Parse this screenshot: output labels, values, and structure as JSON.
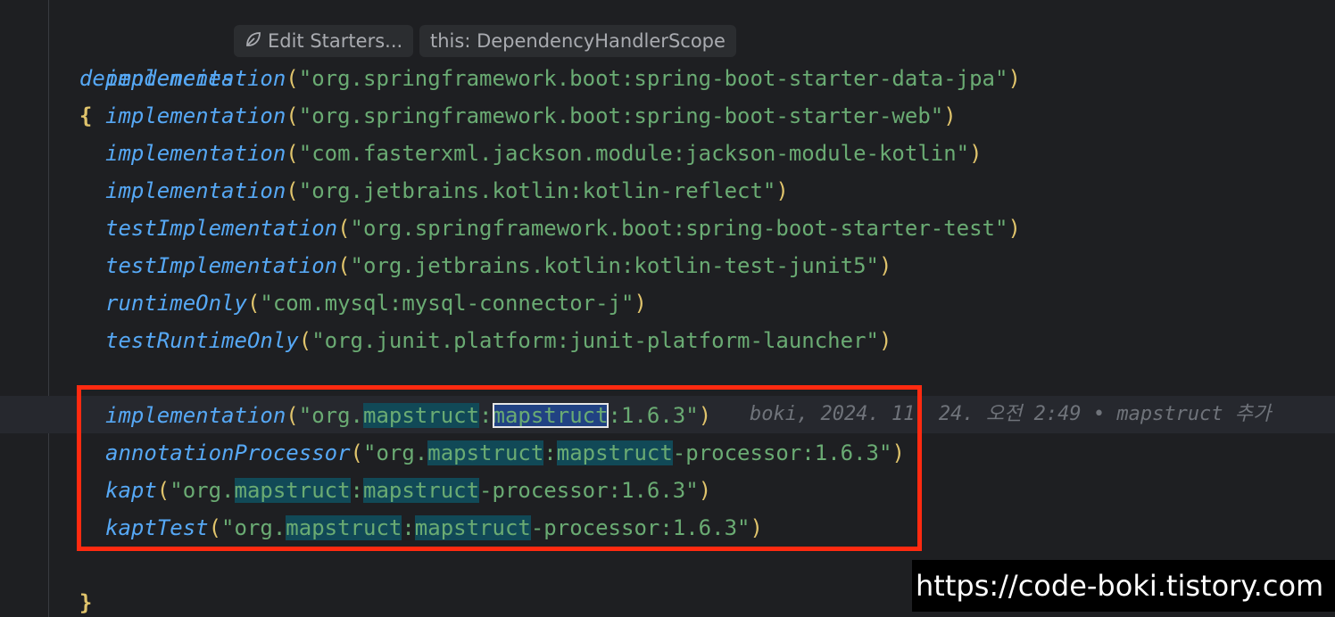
{
  "editor": {
    "block_keyword": "dependencies",
    "open_brace": "{",
    "close_brace": "}",
    "edit_starters_hint": "Edit Starters...",
    "scope_hint": "this: DependencyHandlerScope",
    "lines": [
      {
        "fn": "implementation",
        "pre": "\"org.springframework.boot:spring-boot-starter-data-jpa\""
      },
      {
        "fn": "implementation",
        "pre": "\"org.springframework.boot:spring-boot-starter-web\""
      },
      {
        "fn": "implementation",
        "pre": "\"com.fasterxml.jackson.module:jackson-module-kotlin\""
      },
      {
        "fn": "implementation",
        "pre": "\"org.jetbrains.kotlin:kotlin-reflect\""
      },
      {
        "fn": "testImplementation",
        "pre": "\"org.springframework.boot:spring-boot-starter-test\""
      },
      {
        "fn": "testImplementation",
        "pre": "\"org.jetbrains.kotlin:kotlin-test-junit5\""
      },
      {
        "fn": "runtimeOnly",
        "pre": "\"com.mysql:mysql-connector-j\""
      },
      {
        "fn": "testRuntimeOnly",
        "pre": "\"org.junit.platform:junit-platform-launcher\""
      }
    ],
    "mapstruct_lines": [
      {
        "fn": "implementation",
        "prefix": "\"org.",
        "group": "mapstruct",
        "colon": ":",
        "artifact": "mapstruct",
        "suffix": ":1.6.3\""
      },
      {
        "fn": "annotationProcessor",
        "prefix": "\"org.",
        "group": "mapstruct",
        "colon": ":",
        "artifact": "mapstruct",
        "suffix": "-processor:1.6.3\""
      },
      {
        "fn": "kapt",
        "prefix": "\"org.",
        "group": "mapstruct",
        "colon": ":",
        "artifact": "mapstruct",
        "suffix": "-processor:1.6.3\""
      },
      {
        "fn": "kaptTest",
        "prefix": "\"org.",
        "group": "mapstruct",
        "colon": ":",
        "artifact": "mapstruct",
        "suffix": "-processor:1.6.3\""
      }
    ],
    "open_paren": "(",
    "close_paren": ")",
    "blame_annotation": "boki, 2024. 11. 24. 오전 2:49 • mapstruct 추가"
  },
  "watermark": "https://code-boki.tistory.com",
  "colors": {
    "background": "#1e1f22",
    "keyword": "#56a8f5",
    "string": "#6aab73",
    "brace": "#e0c46c",
    "highlight": "#114957",
    "selection": "#214283",
    "red_box": "#ff2a10"
  },
  "icons": {
    "spring-leaf": "spring-leaf-icon"
  }
}
